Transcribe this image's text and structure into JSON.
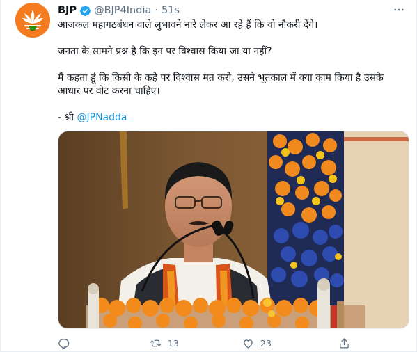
{
  "tweet": {
    "author_name": "BJP",
    "author_handle": "@BJP4India",
    "separator": "·",
    "time": "51s",
    "avatar_icon": "lotus-logo-icon",
    "verified_icon": "verified-badge-icon",
    "more_icon": "more-options-icon",
    "paragraphs": {
      "p1": "आजकल महागठबंधन वाले लुभावने नारे लेकर आ रहे हैं कि वो नौकरी देंगे।",
      "p2": "जनता के सामने प्रश्न है कि इन पर विश्वास किया जा या नहीं?",
      "p3": "मैं कहता हूं कि किसी के कहे पर विश्वास मत करो, उसने भूतकाल में क्या काम किया है उसके आधार पर वोट करना चाहिए।",
      "p4_prefix": "- श्री ",
      "p4_mention": "@JPNadda"
    },
    "media": {
      "description_icon": "tweet-photo"
    },
    "actions": {
      "reply_icon": "reply-icon",
      "retweet_icon": "retweet-icon",
      "retweet_count": "13",
      "like_icon": "like-icon",
      "like_count": "23",
      "share_icon": "share-icon"
    },
    "colors": {
      "accent": "#1b95e0",
      "muted": "#5b7083",
      "avatar_bg": "#f47b20"
    }
  }
}
